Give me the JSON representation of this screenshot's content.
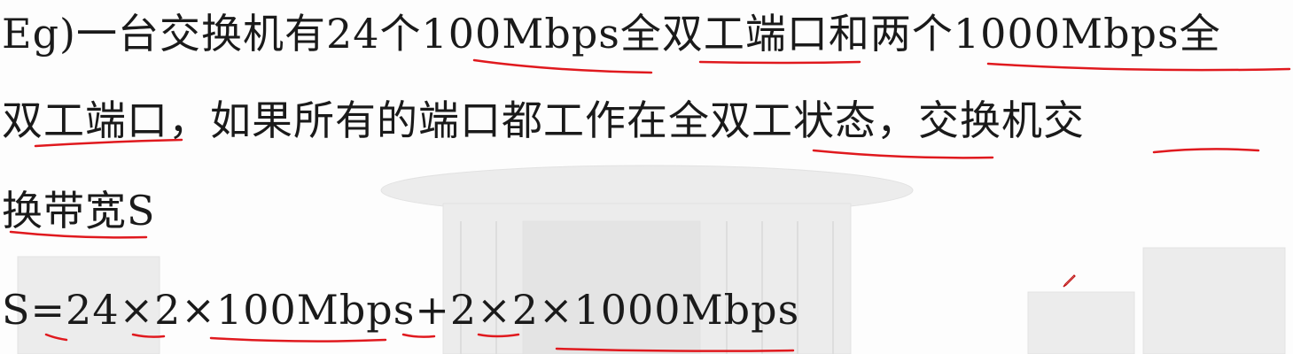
{
  "slide": {
    "problem_line1": "Eg)一台交换机有24个100Mbps全双工端口和两个1000Mbps全",
    "problem_line2": "双工端口，如果所有的端口都工作在全双工状态，交换机交",
    "problem_line3": "换带宽S",
    "formula": "S=24×2×100Mbps+2×2×1000Mbps"
  },
  "colors": {
    "text": "#1a1a1a",
    "annotation": "#e0191e",
    "background_building": "#e6e6e6"
  },
  "icons": [
    "pen-cursor-icon"
  ]
}
